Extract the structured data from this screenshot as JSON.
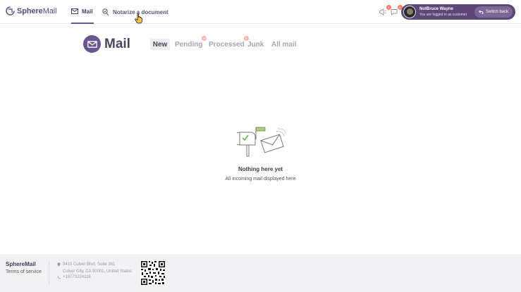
{
  "brand": {
    "bold": "Sphere",
    "light": "Mail"
  },
  "nav": {
    "mail_label": "Mail",
    "notary_label": "Notarize a document"
  },
  "header": {
    "notif_badge_1": "1",
    "notif_badge_2": "1"
  },
  "user": {
    "name": "NotBruce Wayne",
    "subtitle": "You are logged in as customer",
    "switch_label": "Switch back"
  },
  "page": {
    "title": "Mail",
    "tabs": [
      {
        "label": "New",
        "active": true
      },
      {
        "label": "Pending",
        "badge": "15"
      },
      {
        "label": "Processed",
        "badge": "9"
      },
      {
        "label": "Junk"
      },
      {
        "label": "All mail"
      }
    ]
  },
  "empty": {
    "title": "Nothing here yet",
    "subtitle": "All incoming mail displayed here"
  },
  "footer": {
    "brand": "SphereMail",
    "terms": "Terms of service",
    "address_line1": "9415 Culver Blvd, Suite 361",
    "address_line2": "Culver City, CA 90001, United States",
    "phone": "+18773224116"
  },
  "colors": {
    "accent": "#6b5590",
    "pill": "#5c4777",
    "badge": "#ff7a6b"
  }
}
